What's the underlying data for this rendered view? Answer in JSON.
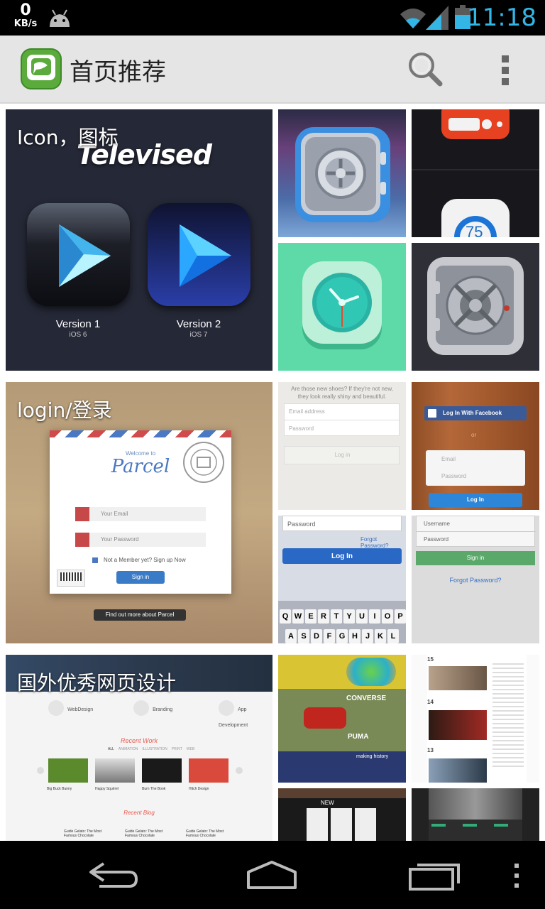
{
  "status_bar": {
    "speed_value": "0",
    "speed_unit": "KB/s",
    "time": "11:18",
    "icons": [
      "android-icon",
      "wifi-icon",
      "signal-icon",
      "battery-icon"
    ],
    "accent_color": "#33b5e5"
  },
  "action_bar": {
    "title": "首页推荐",
    "icons": [
      "app-logo-icon",
      "search-icon",
      "overflow-menu-icon"
    ],
    "logo_color": "#5aaa3c"
  },
  "sections": [
    {
      "label": "Icon，图标",
      "big_tile": {
        "title_art": "Televised",
        "versions": [
          {
            "name": "Version 1",
            "sub": "iOS 6"
          },
          {
            "name": "Version 2",
            "sub": "iOS 7"
          }
        ]
      },
      "thumbnails": [
        {
          "icon": "safe-icon"
        },
        {
          "icon": "radio-thermostat-icon",
          "reading": "75"
        },
        {
          "icon": "clock-icon"
        },
        {
          "icon": "vault-icon"
        }
      ]
    },
    {
      "label": "login/登录",
      "big_tile": {
        "welcome": "Welcome to",
        "brand": "Parcel",
        "email_placeholder": "Your Email",
        "password_placeholder": "Your Password",
        "member_text": "Not a Member yet? Sign up Now",
        "signin_label": "Sign in",
        "footer": "Find out more about Parcel"
      },
      "thumbnails": [
        {
          "text": "Are those new shoes? If they're not new, they look really shiny and beautiful.",
          "fields": [
            "Email address",
            "Password"
          ],
          "button": "Log in"
        },
        {
          "button_fb": "Log In With Facebook",
          "divider": "or",
          "fields": [
            "Email",
            "Password"
          ],
          "button": "Log In"
        },
        {
          "fields": [
            "Password"
          ],
          "link": "Forgot Password?",
          "button": "Log In",
          "keys_row1": [
            "Q",
            "W",
            "E",
            "R",
            "T",
            "Y",
            "U",
            "I",
            "O",
            "P"
          ],
          "keys_row2": [
            "A",
            "S",
            "D",
            "F",
            "G",
            "H",
            "J",
            "K",
            "L"
          ]
        },
        {
          "fields": [
            "Username",
            "Password"
          ],
          "button": "Sign in",
          "link": "Forgot Password?"
        }
      ]
    },
    {
      "label": "国外优秀网页设计",
      "big_tile": {
        "features": [
          "WebDesign",
          "Branding",
          "App Development"
        ],
        "recent_work": "Recent Work",
        "filters": [
          "ALL",
          "ANIMATION",
          "ILLUSTRATION",
          "PRINT",
          "WEB"
        ],
        "works": [
          "Big Buck Bunny",
          "Happy Squirrel",
          "Burn The Book",
          "Hitch Design"
        ],
        "recent_blog": "Recent Blog",
        "blog_posts": [
          "Guide Gelato: The Most Famous Chocolate",
          "Guide Gelato: The Most Famous Chocolate",
          "Guide Gelato: The Most Famous Chocolate"
        ]
      },
      "thumbnails": [
        {
          "brands": [
            "CONVERSE",
            "PUMA"
          ],
          "caption": "making history"
        },
        {
          "dates": [
            "15",
            "14",
            "13"
          ]
        },
        {
          "title": "NEW"
        },
        {}
      ]
    }
  ],
  "nav_bar": {
    "icons": [
      "back-icon",
      "home-icon",
      "recent-apps-icon",
      "menu-icon"
    ]
  }
}
